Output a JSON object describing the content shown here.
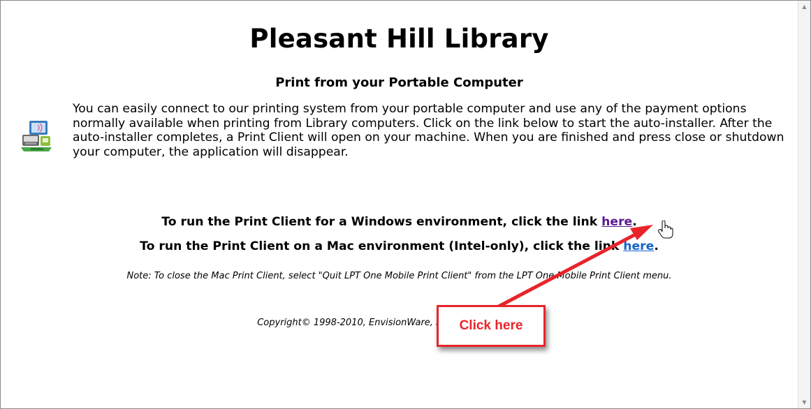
{
  "page": {
    "title": "Pleasant Hill Library",
    "subtitle": "Print from your Portable Computer",
    "intro": "You can easily connect to our printing system from your portable computer and use any of the payment options normally available when printing from Library computers.   Click on the link below to start the auto-installer.  After the auto-installer completes, a Print Client will open on your machine.  When you are finished and press close or shutdown your computer, the application will disappear.",
    "windows_line": {
      "before": "To run the Print Client for a Windows environment, click the link ",
      "link": "here",
      "after": "."
    },
    "mac_line": {
      "before": "To run the Print Client on a Mac environment (Intel-only), click the link ",
      "link": "here",
      "after": "."
    },
    "note": "Note: To close the Mac Print Client, select \"Quit LPT One Mobile Print Client\" from the LPT One Mobile Print Client menu.",
    "copyright": "Copyright© 1998-2010, EnvisionWare, Inc. All rights reserved."
  },
  "annotation": {
    "callout_label": "Click here",
    "color": "#e8242a"
  },
  "icons": {
    "printer": "laptop-printer-icon",
    "cursor": "hand-pointer-icon",
    "scroll_up": "scroll-up-arrow-icon",
    "scroll_down": "scroll-down-arrow-icon"
  },
  "colors": {
    "visited_link": "#5b1a8f",
    "link": "#1463c8"
  }
}
